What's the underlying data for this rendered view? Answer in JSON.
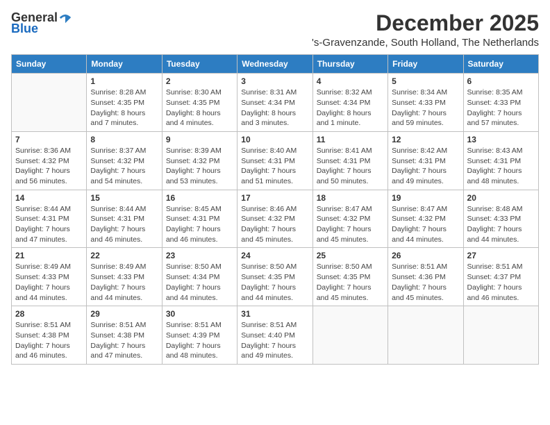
{
  "logo": {
    "general": "General",
    "blue": "Blue"
  },
  "title": "December 2025",
  "location": "'s-Gravenzande, South Holland, The Netherlands",
  "days_of_week": [
    "Sunday",
    "Monday",
    "Tuesday",
    "Wednesday",
    "Thursday",
    "Friday",
    "Saturday"
  ],
  "weeks": [
    [
      {
        "day": "",
        "info": ""
      },
      {
        "day": "1",
        "info": "Sunrise: 8:28 AM\nSunset: 4:35 PM\nDaylight: 8 hours\nand 7 minutes."
      },
      {
        "day": "2",
        "info": "Sunrise: 8:30 AM\nSunset: 4:35 PM\nDaylight: 8 hours\nand 4 minutes."
      },
      {
        "day": "3",
        "info": "Sunrise: 8:31 AM\nSunset: 4:34 PM\nDaylight: 8 hours\nand 3 minutes."
      },
      {
        "day": "4",
        "info": "Sunrise: 8:32 AM\nSunset: 4:34 PM\nDaylight: 8 hours\nand 1 minute."
      },
      {
        "day": "5",
        "info": "Sunrise: 8:34 AM\nSunset: 4:33 PM\nDaylight: 7 hours\nand 59 minutes."
      },
      {
        "day": "6",
        "info": "Sunrise: 8:35 AM\nSunset: 4:33 PM\nDaylight: 7 hours\nand 57 minutes."
      }
    ],
    [
      {
        "day": "7",
        "info": "Sunrise: 8:36 AM\nSunset: 4:32 PM\nDaylight: 7 hours\nand 56 minutes."
      },
      {
        "day": "8",
        "info": "Sunrise: 8:37 AM\nSunset: 4:32 PM\nDaylight: 7 hours\nand 54 minutes."
      },
      {
        "day": "9",
        "info": "Sunrise: 8:39 AM\nSunset: 4:32 PM\nDaylight: 7 hours\nand 53 minutes."
      },
      {
        "day": "10",
        "info": "Sunrise: 8:40 AM\nSunset: 4:31 PM\nDaylight: 7 hours\nand 51 minutes."
      },
      {
        "day": "11",
        "info": "Sunrise: 8:41 AM\nSunset: 4:31 PM\nDaylight: 7 hours\nand 50 minutes."
      },
      {
        "day": "12",
        "info": "Sunrise: 8:42 AM\nSunset: 4:31 PM\nDaylight: 7 hours\nand 49 minutes."
      },
      {
        "day": "13",
        "info": "Sunrise: 8:43 AM\nSunset: 4:31 PM\nDaylight: 7 hours\nand 48 minutes."
      }
    ],
    [
      {
        "day": "14",
        "info": "Sunrise: 8:44 AM\nSunset: 4:31 PM\nDaylight: 7 hours\nand 47 minutes."
      },
      {
        "day": "15",
        "info": "Sunrise: 8:44 AM\nSunset: 4:31 PM\nDaylight: 7 hours\nand 46 minutes."
      },
      {
        "day": "16",
        "info": "Sunrise: 8:45 AM\nSunset: 4:31 PM\nDaylight: 7 hours\nand 46 minutes."
      },
      {
        "day": "17",
        "info": "Sunrise: 8:46 AM\nSunset: 4:32 PM\nDaylight: 7 hours\nand 45 minutes."
      },
      {
        "day": "18",
        "info": "Sunrise: 8:47 AM\nSunset: 4:32 PM\nDaylight: 7 hours\nand 45 minutes."
      },
      {
        "day": "19",
        "info": "Sunrise: 8:47 AM\nSunset: 4:32 PM\nDaylight: 7 hours\nand 44 minutes."
      },
      {
        "day": "20",
        "info": "Sunrise: 8:48 AM\nSunset: 4:33 PM\nDaylight: 7 hours\nand 44 minutes."
      }
    ],
    [
      {
        "day": "21",
        "info": "Sunrise: 8:49 AM\nSunset: 4:33 PM\nDaylight: 7 hours\nand 44 minutes."
      },
      {
        "day": "22",
        "info": "Sunrise: 8:49 AM\nSunset: 4:33 PM\nDaylight: 7 hours\nand 44 minutes."
      },
      {
        "day": "23",
        "info": "Sunrise: 8:50 AM\nSunset: 4:34 PM\nDaylight: 7 hours\nand 44 minutes."
      },
      {
        "day": "24",
        "info": "Sunrise: 8:50 AM\nSunset: 4:35 PM\nDaylight: 7 hours\nand 44 minutes."
      },
      {
        "day": "25",
        "info": "Sunrise: 8:50 AM\nSunset: 4:35 PM\nDaylight: 7 hours\nand 45 minutes."
      },
      {
        "day": "26",
        "info": "Sunrise: 8:51 AM\nSunset: 4:36 PM\nDaylight: 7 hours\nand 45 minutes."
      },
      {
        "day": "27",
        "info": "Sunrise: 8:51 AM\nSunset: 4:37 PM\nDaylight: 7 hours\nand 46 minutes."
      }
    ],
    [
      {
        "day": "28",
        "info": "Sunrise: 8:51 AM\nSunset: 4:38 PM\nDaylight: 7 hours\nand 46 minutes."
      },
      {
        "day": "29",
        "info": "Sunrise: 8:51 AM\nSunset: 4:38 PM\nDaylight: 7 hours\nand 47 minutes."
      },
      {
        "day": "30",
        "info": "Sunrise: 8:51 AM\nSunset: 4:39 PM\nDaylight: 7 hours\nand 48 minutes."
      },
      {
        "day": "31",
        "info": "Sunrise: 8:51 AM\nSunset: 4:40 PM\nDaylight: 7 hours\nand 49 minutes."
      },
      {
        "day": "",
        "info": ""
      },
      {
        "day": "",
        "info": ""
      },
      {
        "day": "",
        "info": ""
      }
    ]
  ]
}
